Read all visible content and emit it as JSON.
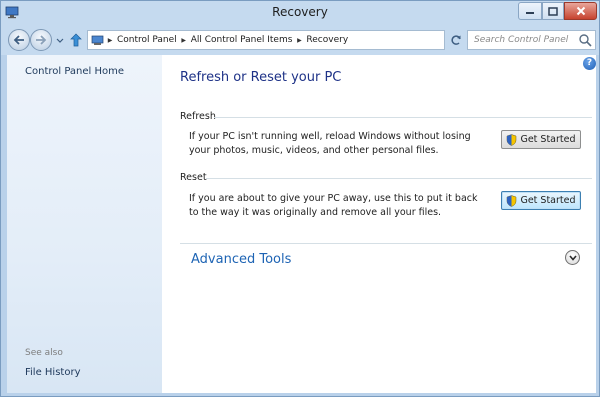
{
  "window": {
    "title": "Recovery"
  },
  "address": {
    "crumbs": [
      "Control Panel",
      "All Control Panel Items",
      "Recovery"
    ],
    "search_placeholder": "Search Control Panel"
  },
  "sidebar": {
    "home_link": "Control Panel Home",
    "see_also_label": "See also",
    "see_also_links": [
      "File History"
    ]
  },
  "main": {
    "title": "Refresh or Reset your PC",
    "sections": [
      {
        "heading": "Refresh",
        "description": "If your PC isn't running well, reload Windows without losing your photos, music, videos, and other personal files.",
        "button_label": "Get Started"
      },
      {
        "heading": "Reset",
        "description": "If you are about to give your PC away, use this to put it back to the way it was originally and remove all your files.",
        "button_label": "Get Started"
      }
    ],
    "advanced_tools_label": "Advanced Tools"
  },
  "icons": {
    "help": "?",
    "app": "recovery-icon",
    "shield": "uac-shield-icon"
  },
  "colors": {
    "title_blue": "#1e3287",
    "link_blue": "#1e64b4",
    "chrome": "#c5daef",
    "sidebar": "#e3edf8"
  }
}
